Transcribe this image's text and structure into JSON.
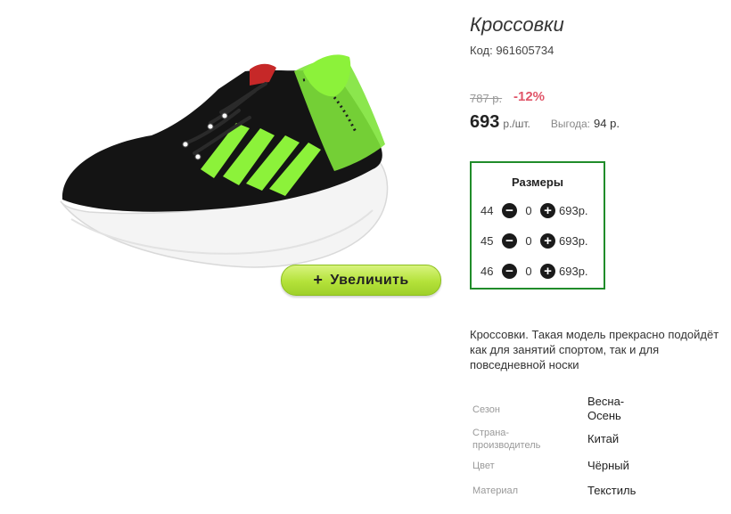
{
  "product": {
    "title": "Кроссовки",
    "code": "Код: 961605734",
    "old_price": "787 р.",
    "discount": "-12%",
    "price": "693",
    "price_unit": "р./шт.",
    "benefit_label": "Выгода:",
    "benefit_value": "94 р."
  },
  "zoom_button": {
    "icon": "plus-icon",
    "label": "Увеличить"
  },
  "sizes": {
    "title": "Размеры",
    "minus_icon": "minus-circle-icon",
    "plus_icon": "plus-circle-icon",
    "items": [
      {
        "size": "44",
        "qty": "0",
        "price": "693р."
      },
      {
        "size": "45",
        "qty": "0",
        "price": "693р."
      },
      {
        "size": "46",
        "qty": "0",
        "price": "693р."
      }
    ]
  },
  "description": "Кроссовки. Такая модель прекрасно подойдёт\nкак для занятий спортом, так и для\nповседневной носки",
  "attributes": [
    {
      "label": "Сезон",
      "value": "Весна-\nОсень"
    },
    {
      "label": "Страна-\nпроизводитель",
      "value": "Китай"
    },
    {
      "label": "Цвет",
      "value": "Чёрный"
    },
    {
      "label": "Материал",
      "value": "Текстиль"
    }
  ],
  "colors": {
    "accent_green": "#b4e23a",
    "border_green": "#208c2a",
    "discount_red": "#e05569"
  }
}
